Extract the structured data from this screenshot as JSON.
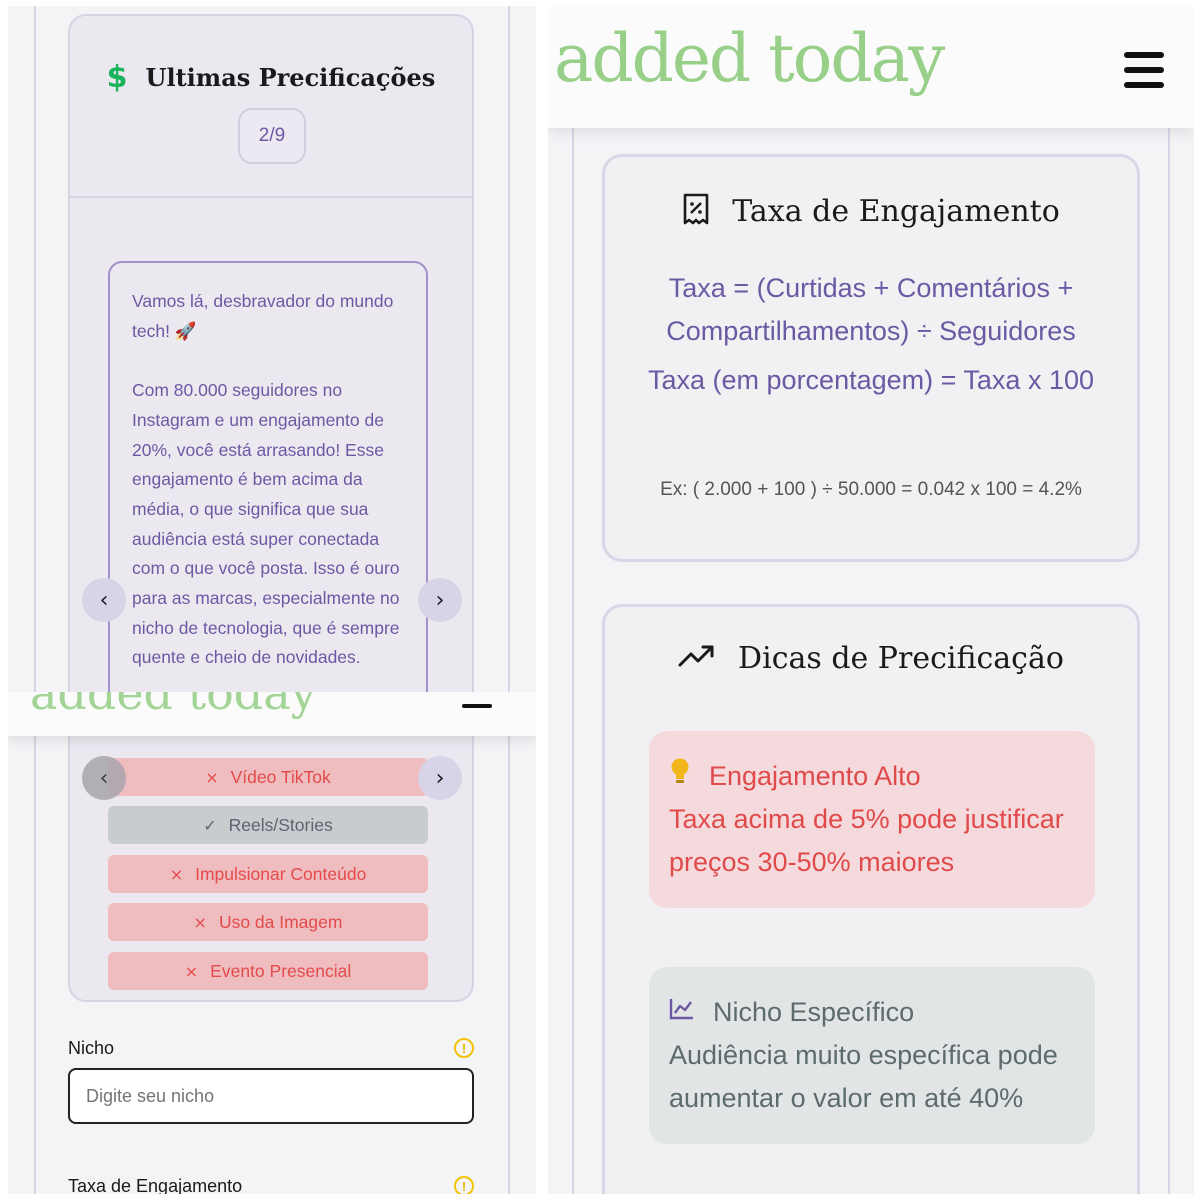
{
  "left_top": {
    "title": "Ultimas Precificações",
    "dollar_symbol": "$",
    "counter": "2/9",
    "message": "Vamos lá, desbravador do mundo tech! 🚀\n\nCom 80.000 seguidores no Instagram e um engajamento de 20%, você está arrasando! Esse engajamento é bem acima da média, o que significa que sua audiência está super conectada com o que você posta. Isso é ouro para as marcas, especialmente no nicho de tecnologia, que é sempre quente e cheio de novidades.",
    "prev_label": "‹",
    "next_label": "›"
  },
  "left_bottom": {
    "watermark": "added today",
    "options": [
      {
        "label": "Vídeo TikTok",
        "mark": "×",
        "status": "excluded"
      },
      {
        "label": "Reels/Stories",
        "mark": "✓",
        "status": "included"
      },
      {
        "label": "Impulsionar Conteúdo",
        "mark": "×",
        "status": "excluded"
      },
      {
        "label": "Uso da Imagem",
        "mark": "×",
        "status": "excluded"
      },
      {
        "label": "Evento Presencial",
        "mark": "×",
        "status": "excluded"
      }
    ],
    "niche_label": "Nicho",
    "niche_placeholder": "Digite seu nicho",
    "engagement_label": "Taxa de Engajamento",
    "info_glyph": "!",
    "prev_label": "‹",
    "next_label": "›"
  },
  "right": {
    "watermark": "added today",
    "engagement_card": {
      "title": "Taxa de Engajamento",
      "formula_1": "Taxa = (Curtidas + Comentários + Compartilhamentos) ÷ Seguidores",
      "formula_2": "Taxa (em porcentagem) = Taxa x 100",
      "example": "Ex: ( 2.000 + 100 ) ÷ 50.000 = 0.042 x 100 = 4.2%"
    },
    "tips_card": {
      "title": "Dicas de Precificação",
      "tips": [
        {
          "heading": "Engajamento Alto",
          "body": "Taxa acima de 5% pode justificar preços 30-50% maiores",
          "icon": "lightbulb-icon"
        },
        {
          "heading": "Nicho Específico",
          "body": "Audiência muito específica pode aumentar o valor em até 40%",
          "icon": "chart-icon"
        }
      ]
    }
  },
  "colors": {
    "accent_purple": "#6b5aa3",
    "success_green": "#1bb35b",
    "danger_red": "#e44b4b",
    "watermark_green": "#98d08a"
  }
}
